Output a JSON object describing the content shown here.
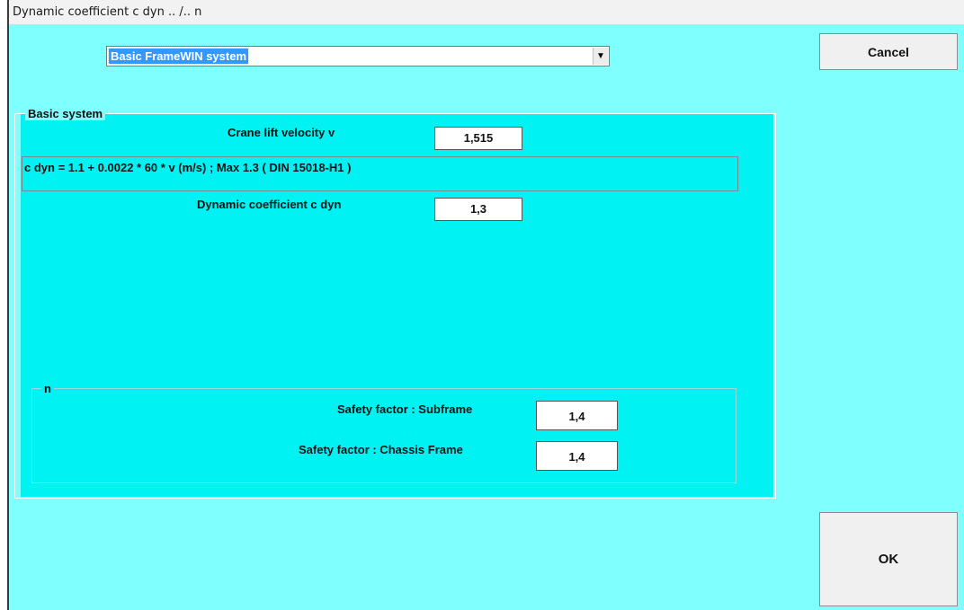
{
  "window": {
    "title": "Dynamic coefficient  c dyn .. /.. n"
  },
  "system_select": {
    "selected": "Basic FrameWIN system"
  },
  "buttons": {
    "cancel": "Cancel",
    "ok": "OK"
  },
  "basic_group": {
    "legend": "Basic system",
    "lift_velocity_label": "Crane lift velocity     v",
    "lift_velocity_value": "1,515",
    "formula": "c dyn = 1.1 + 0.0022 * 60 * v (m/s)  ;   Max  1.3   ( DIN 15018-H1 )",
    "dyn_coeff_label": "Dynamic coefficient  c dyn",
    "dyn_coeff_value": "1,3"
  },
  "n_group": {
    "legend": "n",
    "subframe_label": "Safety factor  :  Subframe",
    "subframe_value": "1,4",
    "chassis_label": "Safety factor  :  Chassis Frame",
    "chassis_value": "1,4"
  },
  "colors": {
    "window_bg": "#80ffff",
    "group_bg": "#00f2f2",
    "selection": "#3399ff"
  }
}
